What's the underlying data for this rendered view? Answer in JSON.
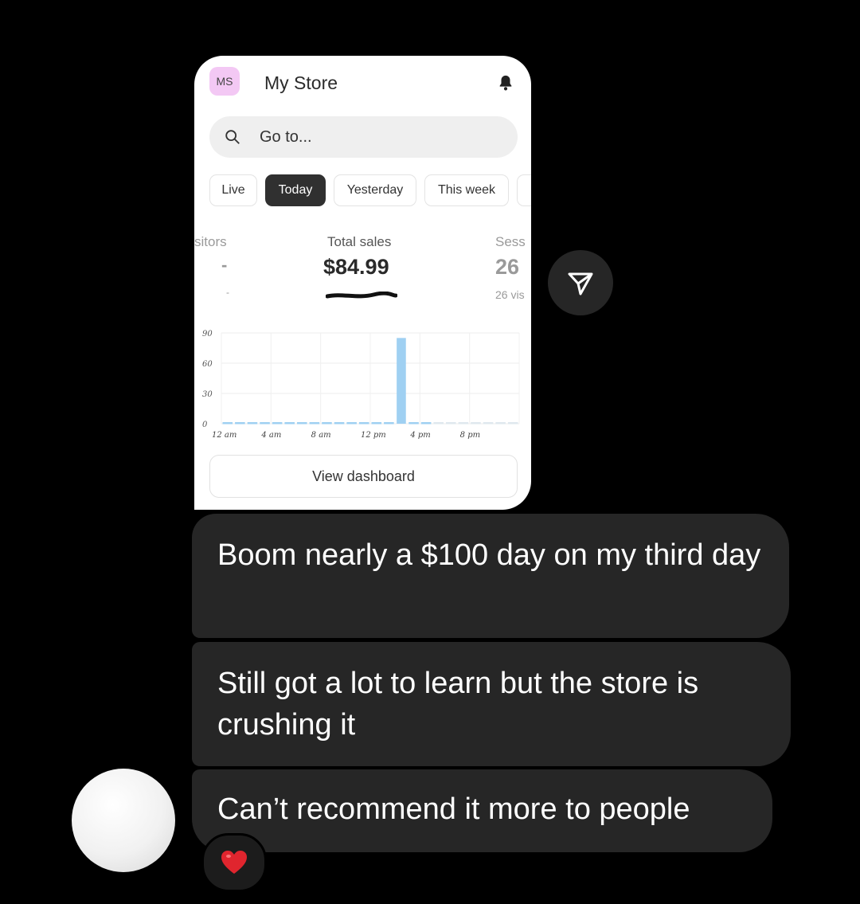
{
  "store_card": {
    "avatar_initials": "MS",
    "store_name": "My Store",
    "search_placeholder": "Go to...",
    "tabs": [
      {
        "label": "Live",
        "active": false
      },
      {
        "label": "Today",
        "active": true
      },
      {
        "label": "Yesterday",
        "active": false
      },
      {
        "label": "This week",
        "active": false
      }
    ],
    "metrics": {
      "left_label": "sitors",
      "left_value": "-",
      "left_sub": "-",
      "center_label": "Total sales",
      "center_value": "$84.99",
      "right_label": "Sess",
      "right_value": "26",
      "right_sub": "26 vis"
    },
    "view_button_label": "View dashboard"
  },
  "chart_data": {
    "type": "bar",
    "x_tick_labels": [
      "12 am",
      "4 am",
      "8 am",
      "12 pm",
      "4 pm",
      "8 pm"
    ],
    "y_ticks": [
      0,
      30,
      60,
      90
    ],
    "ylim": [
      0,
      90
    ],
    "categories": [
      "0",
      "1",
      "2",
      "3",
      "4",
      "5",
      "6",
      "7",
      "8",
      "9",
      "10",
      "11",
      "12",
      "13",
      "14",
      "15",
      "16",
      "17",
      "18",
      "19",
      "20",
      "21",
      "22",
      "23"
    ],
    "values": [
      0,
      0,
      0,
      0,
      0,
      0,
      0,
      0,
      0,
      0,
      0,
      0,
      0,
      0,
      84.99,
      0,
      0,
      0,
      0,
      0,
      0,
      0,
      0,
      0
    ],
    "bar_color": "#9fd0f2"
  },
  "messages": [
    {
      "text": "Boom nearly a $100 day on my third day"
    },
    {
      "text": "Still got a lot to learn but the store is crushing it"
    },
    {
      "text": "Can’t recommend it more to people"
    }
  ],
  "reaction": {
    "emoji": "❤️"
  },
  "icons": {
    "bell": "bell-icon",
    "search": "search-icon",
    "share": "send-icon"
  },
  "colors": {
    "background": "#000000",
    "bubble": "#262626",
    "active_tab": "#303030",
    "avatar_badge": "#f3c8f4"
  }
}
